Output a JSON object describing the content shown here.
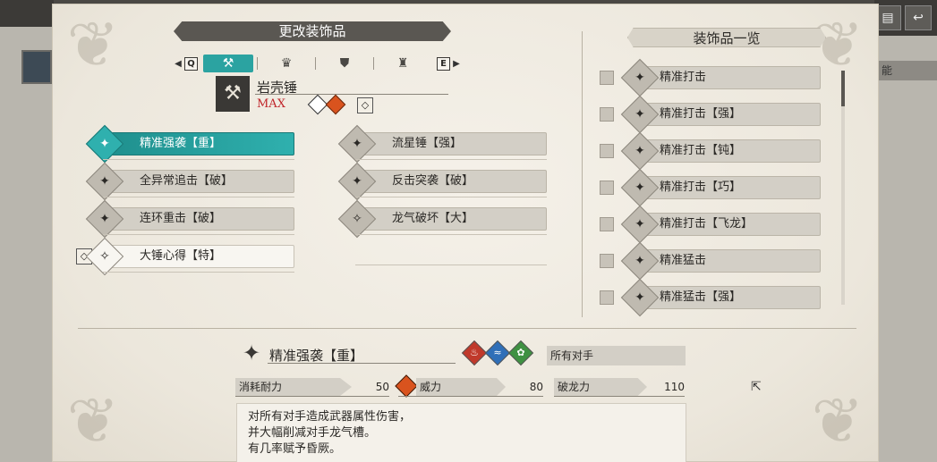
{
  "header": {
    "title": "更改装饰品",
    "list_title": "装饰品一览"
  },
  "tabs": {
    "left_key": "Q",
    "right_key": "E",
    "items": [
      {
        "icon": "hammer-icon",
        "active": true
      },
      {
        "icon": "armor-head-icon",
        "active": false
      },
      {
        "icon": "armor-chest-icon",
        "active": false
      },
      {
        "icon": "armor-arms-icon",
        "active": false
      }
    ]
  },
  "weapon": {
    "name": "岩壳锤",
    "level": "MAX"
  },
  "skills_left": [
    {
      "label": "精准强袭【重】",
      "state": "active"
    },
    {
      "label": "全异常追击【破】",
      "state": "normal"
    },
    {
      "label": "连环重击【破】",
      "state": "normal"
    },
    {
      "label": "大锤心得【特】",
      "state": "white"
    }
  ],
  "skills_right": [
    {
      "label": "流星锤【强】"
    },
    {
      "label": "反击突袭【破】"
    },
    {
      "label": "龙气破坏【大】"
    }
  ],
  "decoration_list": [
    "精准打击",
    "精准打击【强】",
    "精准打击【钝】",
    "精准打击【巧】",
    "精准打击【飞龙】",
    "精准猛击",
    "精准猛击【强】"
  ],
  "detail": {
    "name": "精准强袭【重】",
    "target": "所有对手",
    "stats": [
      {
        "label": "消耗耐力",
        "value": "50"
      },
      {
        "label": "威力",
        "value": "80"
      },
      {
        "label": "破龙力",
        "value": "110"
      }
    ],
    "description": [
      "对所有对手造成武器属性伤害，",
      "并大幅削减对手龙气槽。",
      "有几率赋予昏厥。"
    ]
  },
  "right_bar_text": "能"
}
